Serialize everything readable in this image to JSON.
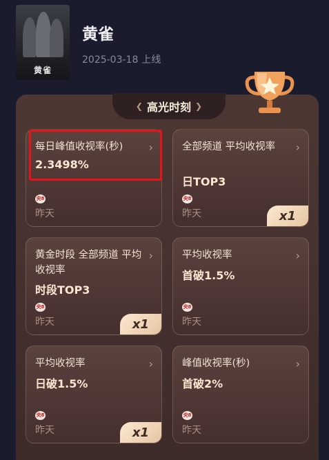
{
  "drama": {
    "poster_title": "黄雀",
    "title": "黄雀",
    "date": "2025-03-18",
    "status": "上线"
  },
  "highlights": {
    "header": "高光时刻",
    "cards": [
      {
        "title": "每日峰值收视率(秒)",
        "value": "2.3498%",
        "channel": "央8",
        "day": "昨天",
        "badge": ""
      },
      {
        "title": "全部频道 平均收视率",
        "value": "日TOP3",
        "channel": "央8",
        "day": "昨天",
        "badge": "x1"
      },
      {
        "title": "黄金时段 全部频道 平均收视率",
        "value": "时段TOP3",
        "channel": "央8",
        "day": "昨天",
        "badge": "x1"
      },
      {
        "title": "平均收视率",
        "value": "首破1.5%",
        "channel": "央8",
        "day": "昨天",
        "badge": ""
      },
      {
        "title": "平均收视率",
        "value": "日破1.5%",
        "channel": "央8",
        "day": "昨天",
        "badge": "x1"
      },
      {
        "title": "峰值收视率(秒)",
        "value": "首破2%",
        "channel": "央8",
        "day": "昨天",
        "badge": ""
      }
    ]
  },
  "colors": {
    "background": "#1a1b2c",
    "panel": "#4d3733",
    "card": "#5a423d",
    "badge": "#fbe8d0",
    "highlight_border": "#e5141a",
    "trophy": "#f0a15c"
  }
}
